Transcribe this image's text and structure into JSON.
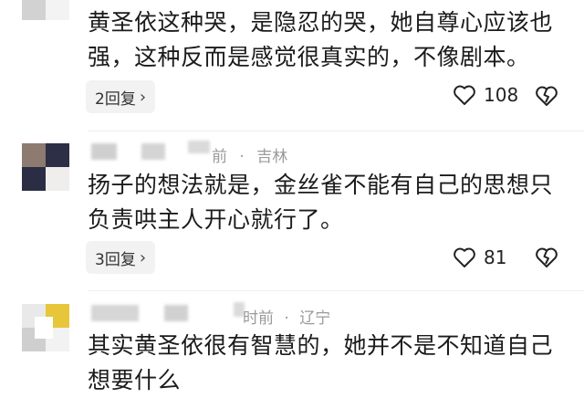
{
  "comments": [
    {
      "body_line1": "黄圣依这种哭，是隐忍的哭，她自尊心应该也",
      "body_line2": "强，这种反而是感觉很真实的，不像剧本。",
      "reply_label": "2回复",
      "likes": "108",
      "like_icon": "heart-outline-icon",
      "dislike_icon": "broken-heart-icon"
    },
    {
      "meta_partial": "前",
      "location": "吉林",
      "body_line1": "扬子的想法就是，金丝雀不能有自己的思想只",
      "body_line2": "负责哄主人开心就行了。",
      "reply_label": "3回复",
      "likes": "81",
      "like_icon": "heart-outline-icon",
      "dislike_icon": "broken-heart-icon"
    },
    {
      "meta_time": "时前",
      "location": "辽宁",
      "body_line1": "其实黄圣依很有智慧的，她并不是不知道自己",
      "body_line2": "想要什么"
    }
  ],
  "colors": {
    "text": "#1b1b1b",
    "meta": "#9a9a9a",
    "reply_bg": "#f2f2f2"
  }
}
